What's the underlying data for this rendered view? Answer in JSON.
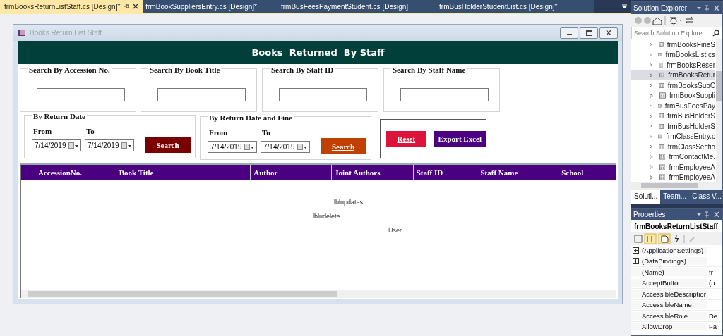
{
  "doc_tabs": [
    {
      "label": "frmBooksReturnListStaff.cs [Design]*",
      "selected": true
    },
    {
      "label": "frmBookSuppliersEntry.cs [Design]*",
      "selected": false
    },
    {
      "label": "frmBusFeesPaymentStudent.cs [Design]",
      "selected": false
    },
    {
      "label": "frmBusHolderStudentList.cs [Design]*",
      "selected": false
    }
  ],
  "form": {
    "title": "Books Return List Staff",
    "header": "Books  Returned  By Staff",
    "search_groups": [
      {
        "label": "Search By Accession No."
      },
      {
        "label": "Search By Book Title"
      },
      {
        "label": "Search By Staff ID"
      },
      {
        "label": "Search By Staff Name"
      }
    ],
    "date_groups": [
      {
        "label": "By Return Date",
        "from_label": "From",
        "to_label": "To",
        "from": "7/14/2019",
        "to": "7/14/2019",
        "button": "Search",
        "color": "#7a0000"
      },
      {
        "label": "By Return Date and Fine",
        "from_label": "From",
        "to_label": "To",
        "from": "7/14/2019",
        "to": "7/14/2019",
        "button": "Search",
        "color": "#c04000"
      }
    ],
    "action_buttons": [
      {
        "label": "Reset",
        "color": "#dc143c"
      },
      {
        "label": "Export Excel",
        "color": "#4b0082"
      }
    ],
    "grid": {
      "columns": [
        "AccessionNo.",
        "Book Title",
        "Author",
        "Joint Authors",
        "Staff ID",
        "Staff Name",
        "School"
      ],
      "labels": [
        "lblupdates",
        "lbludelete",
        "User"
      ]
    }
  },
  "solution_explorer": {
    "title": "Solution Explorer",
    "search_placeholder": "Search Solution Explorer",
    "items": [
      {
        "label": "frmBooksFineS",
        "selected": false
      },
      {
        "label": "frmBooksList.cs",
        "selected": false
      },
      {
        "label": "frmBooksReser",
        "selected": false
      },
      {
        "label": "frmBooksRetur",
        "selected": true
      },
      {
        "label": "frmBooksSubC",
        "selected": false
      },
      {
        "label": "frmBookSuppli",
        "selected": false
      },
      {
        "label": "frmBusFeesPay",
        "selected": false
      },
      {
        "label": "frmBusHolderS",
        "selected": false
      },
      {
        "label": "frmBusHolderS",
        "selected": false
      },
      {
        "label": "frmClassEntry.c",
        "selected": false
      },
      {
        "label": "frmClassSectio",
        "selected": false
      },
      {
        "label": "frmContactMe.",
        "selected": false
      },
      {
        "label": "frmEmployeeA",
        "selected": false
      },
      {
        "label": "frmEmployeeA",
        "selected": false
      }
    ],
    "tabs": [
      {
        "label": "Soluti...",
        "selected": true
      },
      {
        "label": "Team...",
        "selected": false
      },
      {
        "label": "Class V...",
        "selected": false
      }
    ]
  },
  "properties": {
    "title": "Properties",
    "object": "frmBooksReturnListStaff",
    "rows": [
      {
        "name": "(ApplicationSettings)",
        "value": "",
        "group": true
      },
      {
        "name": "(DataBindings)",
        "value": "",
        "group": true
      },
      {
        "name": "(Name)",
        "value": "fr",
        "group": false
      },
      {
        "name": "AcceptButton",
        "value": "(n",
        "group": false
      },
      {
        "name": "AccessibleDescriptior",
        "value": "",
        "group": false
      },
      {
        "name": "AccessibleName",
        "value": "",
        "group": false
      },
      {
        "name": "AccessibleRole",
        "value": "De",
        "group": false
      },
      {
        "name": "AllowDrop",
        "value": "Fa",
        "group": false
      }
    ]
  }
}
